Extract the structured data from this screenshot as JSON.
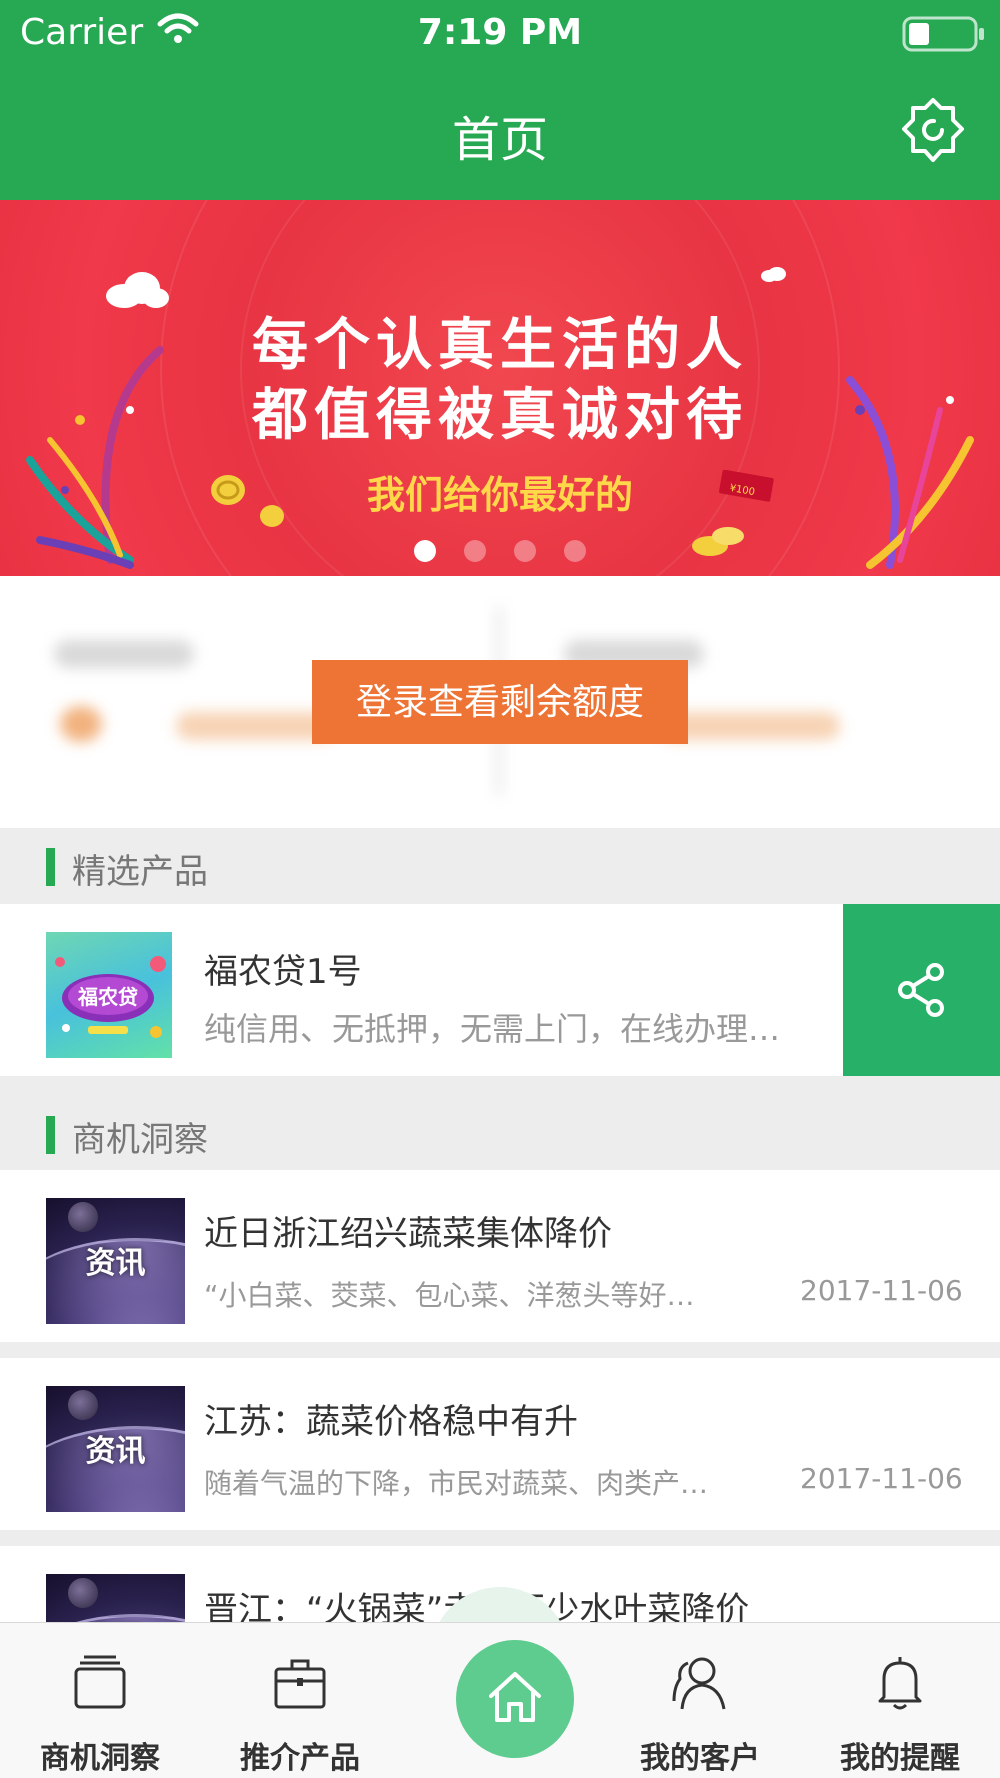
{
  "status_bar": {
    "carrier": "Carrier",
    "time": "7:19 PM"
  },
  "nav": {
    "title": "首页",
    "settings_icon": "gear-icon"
  },
  "banner": {
    "line1": "每个认真生活的人",
    "line2": "都值得被真诚对待",
    "line3": "我们给你最好的",
    "red_envelope": "¥100",
    "page_count": 4,
    "active_page": 1
  },
  "credit": {
    "login_label": "登录查看剩余额度"
  },
  "featured": {
    "section_title": "精选产品",
    "product": {
      "name": "福农贷1号",
      "thumb_text": "福农贷",
      "desc": "纯信用、无抵押，无需上门，在线办理…"
    }
  },
  "insights": {
    "section_title": "商机洞察",
    "thumb_label": "资讯",
    "items": [
      {
        "title": "近日浙江绍兴蔬菜集体降价",
        "summary": "“小白菜、茭菜、包心菜、洋葱头等好…",
        "date": "2017-11-06"
      },
      {
        "title": "江苏：蔬菜价格稳中有升",
        "summary": "随着气温的下降，市民对蔬菜、肉类产…",
        "date": "2017-11-06"
      },
      {
        "title": "晋江：“火锅菜”走市不少水叶菜降价",
        "summary": "",
        "date": ""
      }
    ]
  },
  "tabbar": {
    "items": [
      {
        "label": "商机洞察",
        "icon": "cards-icon"
      },
      {
        "label": "推介产品",
        "icon": "briefcase-icon"
      },
      {
        "label": "",
        "icon": "home-icon"
      },
      {
        "label": "我的客户",
        "icon": "users-icon"
      },
      {
        "label": "我的提醒",
        "icon": "bell-icon"
      }
    ]
  },
  "colors": {
    "brand_green": "#27a853",
    "accent_orange": "#ee7436",
    "banner_red": "#e83443",
    "share_green": "#27b067"
  }
}
